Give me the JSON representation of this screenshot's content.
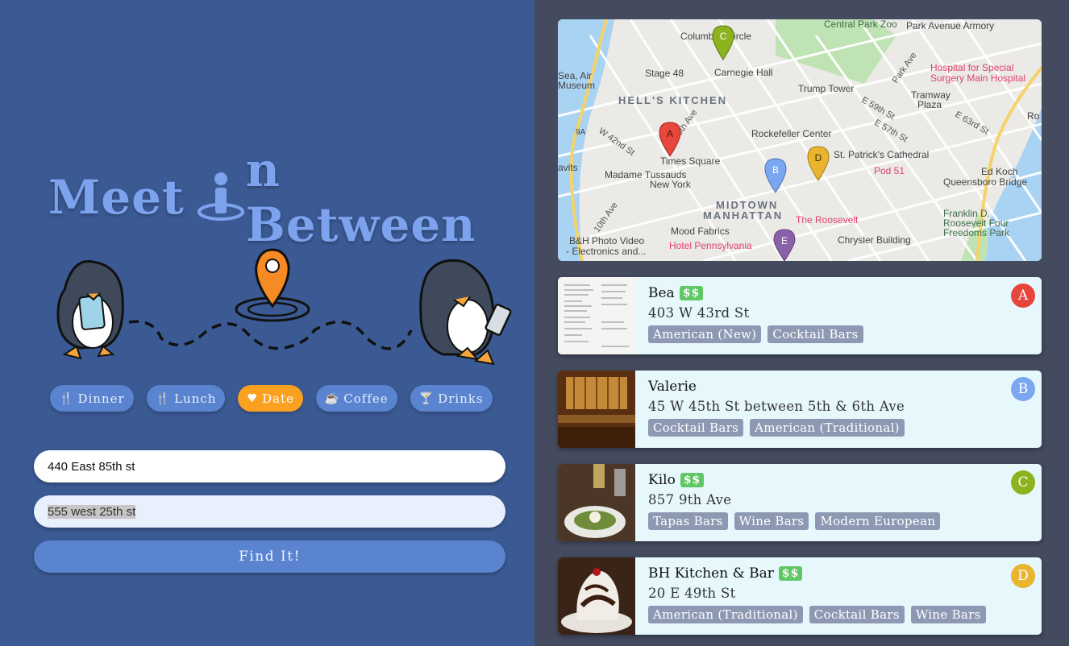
{
  "app": {
    "title_part1": "Meet ",
    "title_part2": "n Between"
  },
  "categories": [
    {
      "label": "Dinner",
      "icon": "utensils-icon",
      "active": false
    },
    {
      "label": "Lunch",
      "icon": "utensils-icon",
      "active": false
    },
    {
      "label": "Date",
      "icon": "heart-icon",
      "active": true
    },
    {
      "label": "Coffee",
      "icon": "coffee-icon",
      "active": false
    },
    {
      "label": "Drinks",
      "icon": "cocktail-icon",
      "active": false
    }
  ],
  "form": {
    "address1": "440 East 85th st",
    "address2": "555 west 25th st",
    "find_label": "Find It!"
  },
  "map": {
    "labels": {
      "central_park_zoo": "Central Park Zoo",
      "park_avenue_armory": "Park Avenue Armory",
      "columbus_circle": "Columbus Circle",
      "hospital": "Hospital for Special",
      "hospital2": "Surgery Main Hospital",
      "sea_air": "Sea, Air",
      "museum": "Museum",
      "stage48": "Stage 48",
      "carnegie": "Carnegie Hall",
      "trump": "Trump Tower",
      "hells_kitchen": "HELL'S KITCHEN",
      "tramway": "Tramway",
      "plaza": "Plaza",
      "rockefeller": "Rockefeller Center",
      "times_square": "Times Square",
      "st_patricks": "St. Patrick's Cathedral",
      "tussauds": "Madame Tussauds",
      "new_york": "New York",
      "pod51": "Pod 51",
      "ed_koch": "Ed Koch",
      "queensboro": "Queensboro Bridge",
      "midtown": "MIDTOWN",
      "manhattan": "MANHATTAN",
      "roosevelt": "The Roosevelt",
      "franklin": "Franklin D.",
      "roosevelt_four": "Roosevelt Four",
      "freedoms": "Freedoms Park",
      "mood": "Mood Fabrics",
      "chrysler": "Chrysler Building",
      "bh1": "B&H Photo Video",
      "bh2": "- Electronics and...",
      "pennsylvania": "Hotel Pennsylvania",
      "javits": "avits",
      "w42": "W 42nd St",
      "ninth": "9th Ave",
      "tenth": "10th Ave",
      "e59": "E 59th St",
      "e57": "E 57th St",
      "e63": "E 63rd St",
      "park_ave": "Park Ave",
      "ro": "Ro",
      "route9a": "9A"
    },
    "markers": [
      {
        "letter": "A",
        "color": "#e8453c"
      },
      {
        "letter": "B",
        "color": "#7ba7f0"
      },
      {
        "letter": "C",
        "color": "#8cb31d"
      },
      {
        "letter": "D",
        "color": "#e9b42e"
      },
      {
        "letter": "E",
        "color": "#8b62a8"
      }
    ]
  },
  "results": [
    {
      "name": "Bea",
      "price": "$$",
      "address": "403 W 43rd St",
      "tags": [
        "American (New)",
        "Cocktail Bars"
      ],
      "marker": "A",
      "marker_color": "#e8453c"
    },
    {
      "name": "Valerie",
      "price": "",
      "address": "45 W 45th St between 5th & 6th Ave",
      "tags": [
        "Cocktail Bars",
        "American (Traditional)"
      ],
      "marker": "B",
      "marker_color": "#7ba7f0"
    },
    {
      "name": "Kilo",
      "price": "$$",
      "address": "857 9th Ave",
      "tags": [
        "Tapas Bars",
        "Wine Bars",
        "Modern European"
      ],
      "marker": "C",
      "marker_color": "#8cb31d"
    },
    {
      "name": "BH Kitchen & Bar",
      "price": "$$",
      "address": "20 E 49th St",
      "tags": [
        "American (Traditional)",
        "Cocktail Bars",
        "Wine Bars"
      ],
      "marker": "D",
      "marker_color": "#e9b42e"
    }
  ]
}
